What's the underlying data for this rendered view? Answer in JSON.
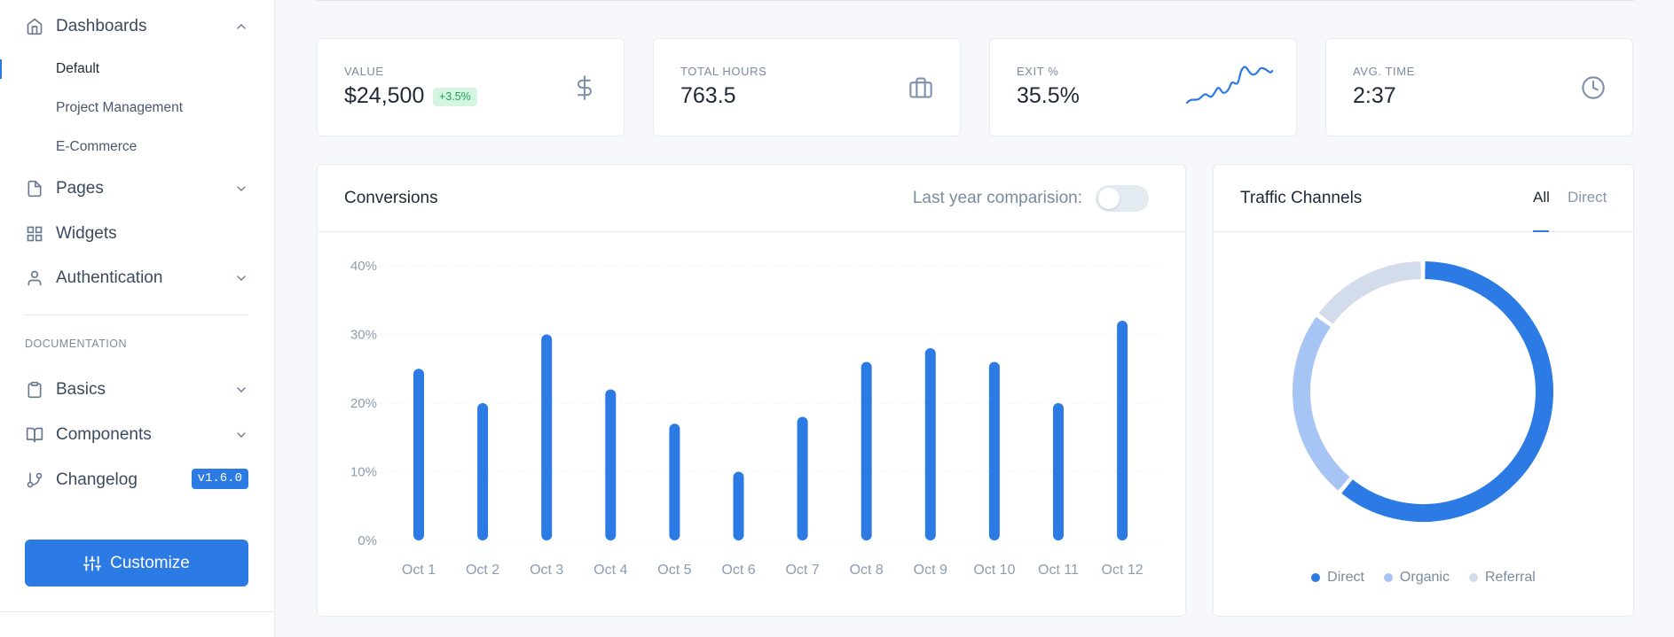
{
  "sidebar": {
    "dashboards": {
      "label": "Dashboards",
      "icon": "home-icon"
    },
    "dashboard_items": [
      {
        "label": "Default",
        "active": true
      },
      {
        "label": "Project Management",
        "active": false
      },
      {
        "label": "E-Commerce",
        "active": false
      }
    ],
    "pages": {
      "label": "Pages",
      "icon": "file-icon"
    },
    "widgets": {
      "label": "Widgets",
      "icon": "grid-icon"
    },
    "authentication": {
      "label": "Authentication",
      "icon": "user-icon"
    },
    "section_label": "DOCUMENTATION",
    "basics": {
      "label": "Basics",
      "icon": "clipboard-icon"
    },
    "components": {
      "label": "Components",
      "icon": "book-icon"
    },
    "changelog": {
      "label": "Changelog",
      "icon": "git-branch-icon",
      "badge": "v1.6.0"
    },
    "customize_label": "Customize"
  },
  "stats": [
    {
      "label": "VALUE",
      "value": "$24,500",
      "badge": "+3.5%",
      "icon": "dollar-icon"
    },
    {
      "label": "TOTAL HOURS",
      "value": "763.5",
      "icon": "briefcase-icon"
    },
    {
      "label": "EXIT %",
      "value": "35.5%",
      "icon": "sparkline"
    },
    {
      "label": "AVG. TIME",
      "value": "2:37",
      "icon": "clock-icon"
    }
  ],
  "conversions": {
    "title": "Conversions",
    "toggle_label": "Last year comparision:",
    "toggle_on": false
  },
  "traffic": {
    "title": "Traffic Channels",
    "tabs": [
      "All",
      "Direct"
    ],
    "active_tab": "All"
  },
  "colors": {
    "primary": "#2c7be5",
    "organic": "#a6c5f4",
    "referral": "#d3dcea",
    "badge_bg": "#d4f5e2",
    "badge_text": "#1fa15a"
  },
  "chart_data": [
    {
      "type": "bar",
      "title": "Conversions",
      "categories": [
        "Oct 1",
        "Oct 2",
        "Oct 3",
        "Oct 4",
        "Oct 5",
        "Oct 6",
        "Oct 7",
        "Oct 8",
        "Oct 9",
        "Oct 10",
        "Oct 11",
        "Oct 12"
      ],
      "values": [
        25,
        20,
        30,
        22,
        17,
        10,
        18,
        26,
        28,
        26,
        20,
        32
      ],
      "yticks": [
        "0%",
        "10%",
        "20%",
        "30%",
        "40%"
      ],
      "ylim": [
        0,
        40
      ],
      "grid": true,
      "color": "#2c7be5"
    },
    {
      "type": "pie",
      "title": "Traffic Channels",
      "labels": [
        "Direct",
        "Organic",
        "Referral"
      ],
      "values": [
        61,
        24,
        15
      ],
      "colors": [
        "#2c7be5",
        "#a6c5f4",
        "#d3dcea"
      ],
      "legend": "bottom"
    }
  ]
}
